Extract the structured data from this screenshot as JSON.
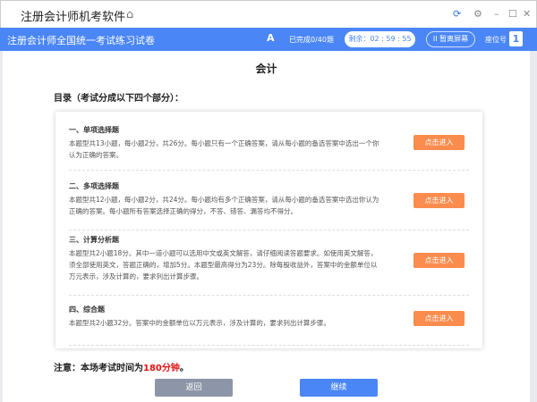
{
  "app": {
    "title": "注册会计师机考软件"
  },
  "bar": {
    "exam_title": "注册会计师全国统一考试练习试卷",
    "font_icon": "A",
    "progress": "已完成0/40题",
    "timer": "剩余：02 : 59 : 55",
    "pause": "II 暂离屏幕",
    "seat_label": "座位号",
    "seat_no": "1"
  },
  "main": {
    "title": "会计",
    "toc": "目录（考试分成以下四个部分）：",
    "sections": [
      {
        "title": "一、单项选择题",
        "desc": "本题型共13小题，每小题2分，共26分。每小题只有一个正确答案，请从每小题的备选答案中选出一个你认为正确的答案。",
        "button": "点击进入"
      },
      {
        "title": "二、多项选择题",
        "desc": "本题型共12小题，每小题2分，共24分。每小题均有多个正确答案，请从每小题的备选答案中选出你认为正确的答案。每小题所有答案选择正确的得分，不答、错答、漏答均不得分。",
        "button": "点击进入"
      },
      {
        "title": "三、计算分析题",
        "desc": "本题型共2小题18分。其中一道小题可以选用中文或英文解答，请仔细阅读答题要求。如使用英文解答，须全部使用英文，答题正确的，增加5分。本题型最高得分为23分。除每股收益外，答案中的金额单位以万元表示，涉及计算的，要求列出计算步骤。",
        "button": "点击进入"
      },
      {
        "title": "四、综合题",
        "desc": "本题型共2小题32分。答案中的金额单位以万元表示，涉及计算的，要求列出计算步骤。",
        "button": "点击进入"
      }
    ],
    "notice_prefix": "注意：本场考试时间为",
    "notice_time": "180分钟",
    "notice_suffix": "。",
    "back": "返回",
    "continue": "继续"
  }
}
